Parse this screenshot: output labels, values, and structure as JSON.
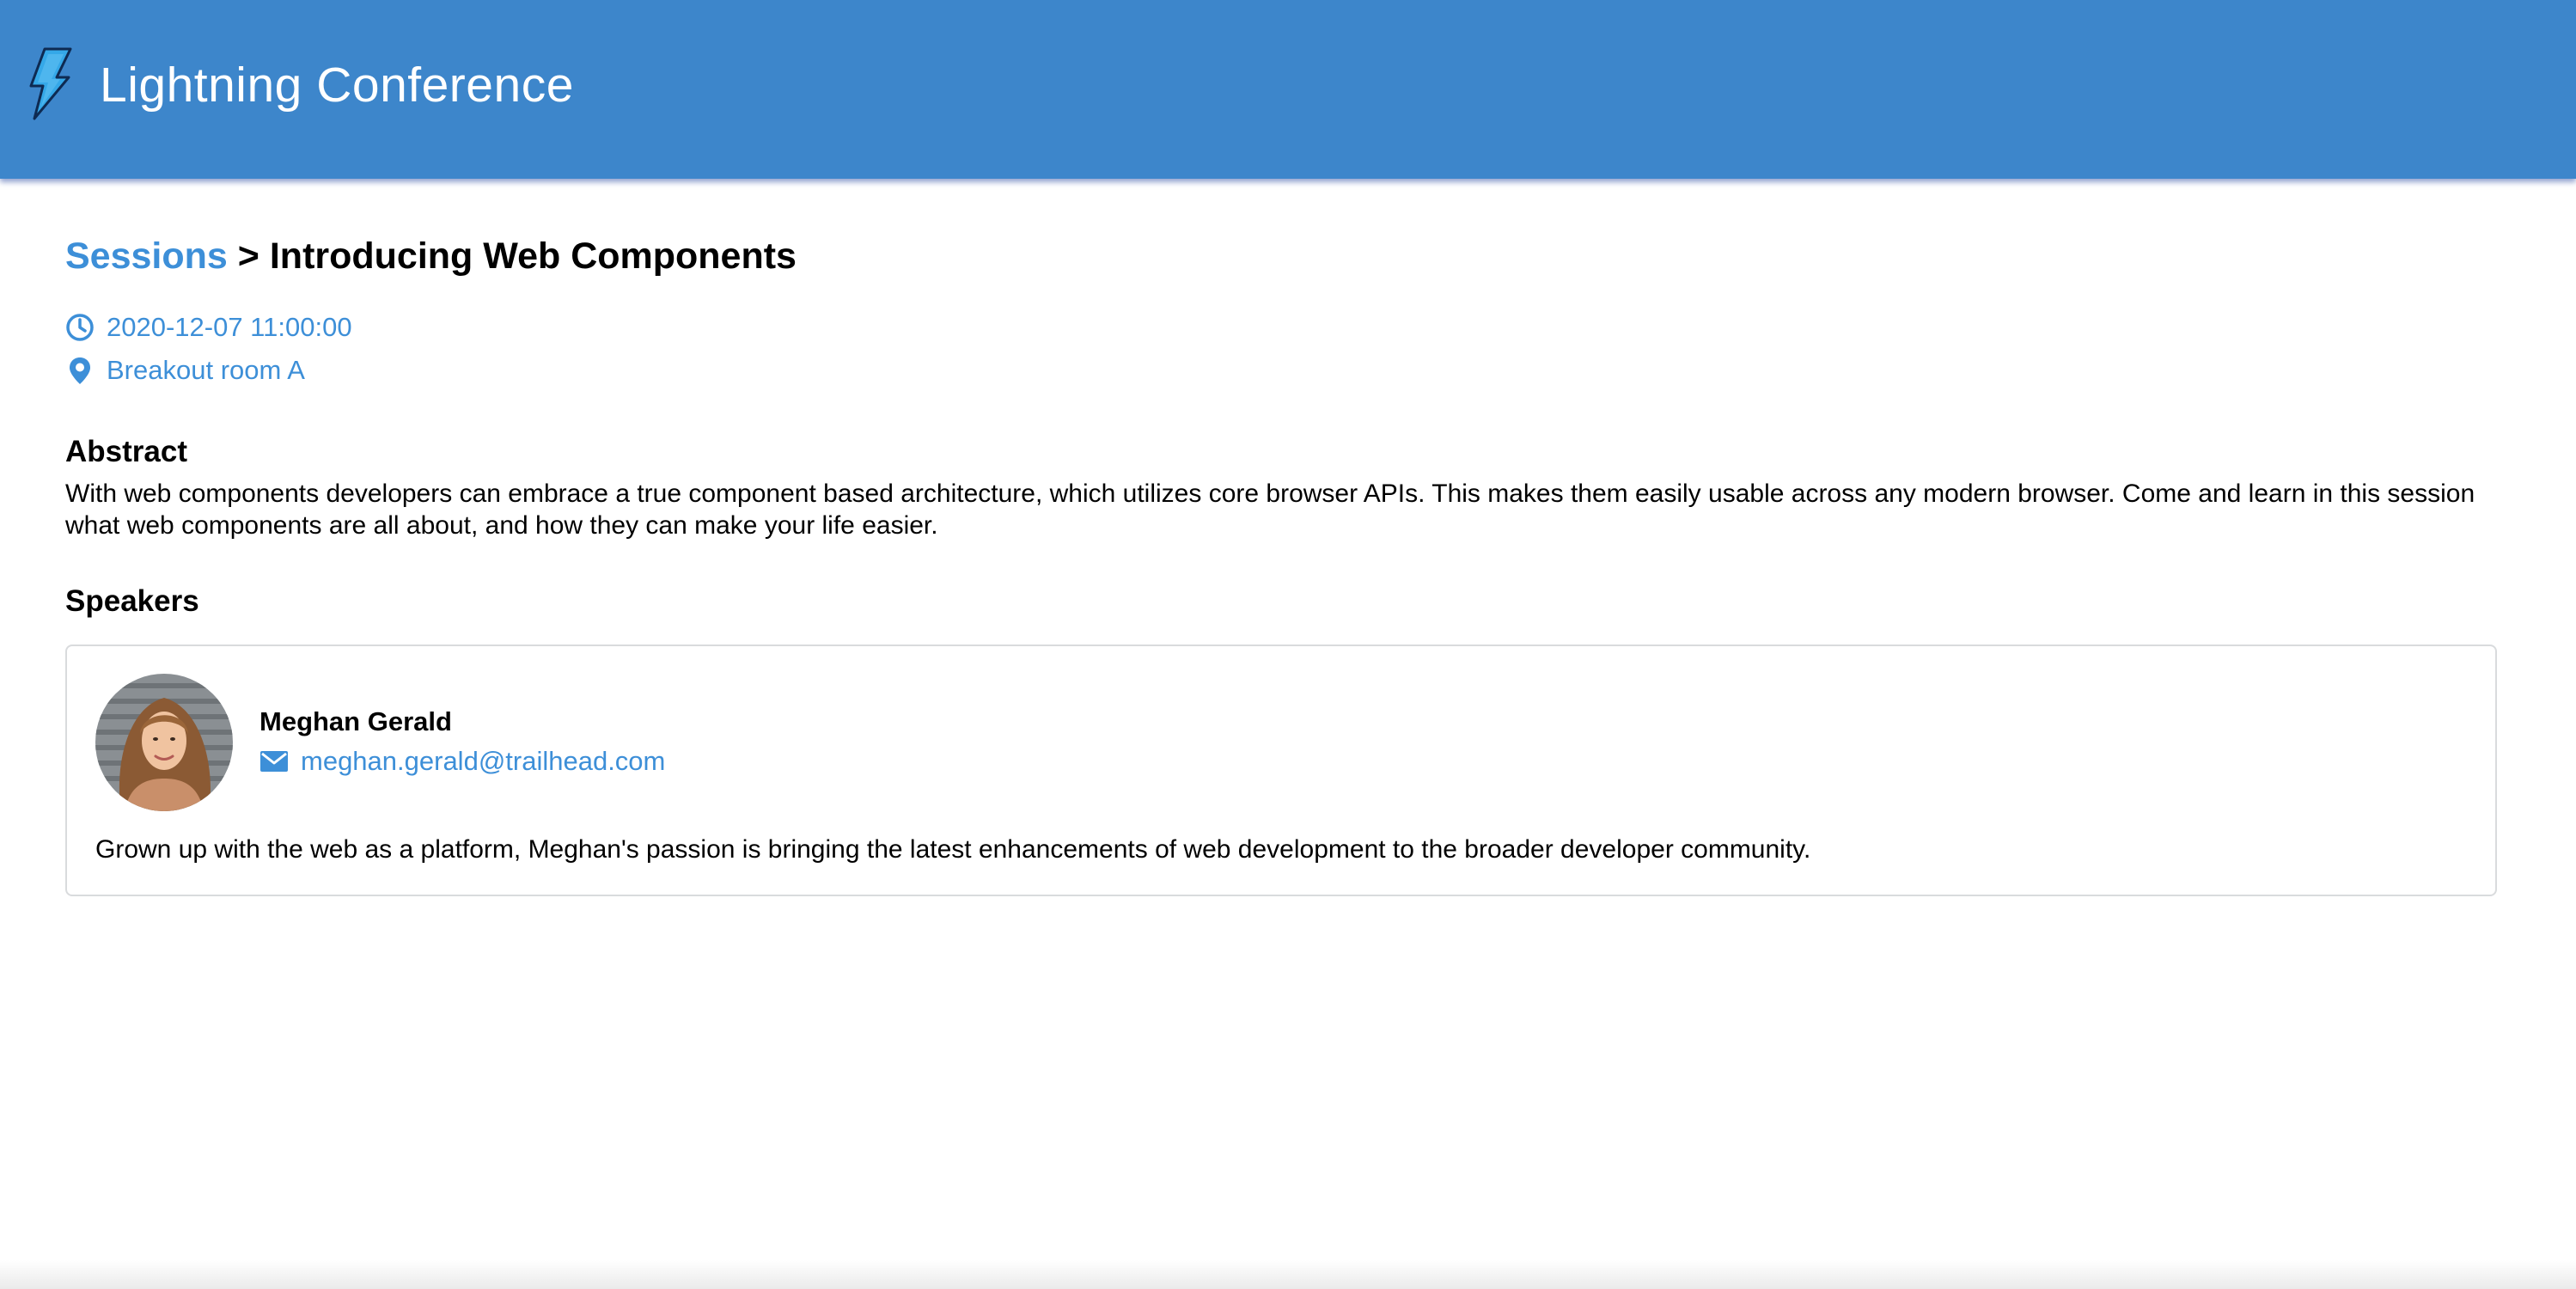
{
  "header": {
    "logo_icon": "lightning-bolt-icon",
    "title": "Lightning Conference"
  },
  "breadcrumb": {
    "parent": "Sessions",
    "separator": ">",
    "current": "Introducing Web Components"
  },
  "session": {
    "datetime": "2020-12-07 11:00:00",
    "datetime_icon": "clock-icon",
    "room": "Breakout room A",
    "room_icon": "location-pin-icon"
  },
  "abstract": {
    "heading": "Abstract",
    "text": "With web components developers can embrace a true component based architecture, which utilizes core browser APIs. This makes them easily usable across any modern browser. Come and learn in this session what web components are all about, and how they can make your life easier."
  },
  "speakers": {
    "heading": "Speakers",
    "items": [
      {
        "name": "Meghan Gerald",
        "email": "meghan.gerald@trailhead.com",
        "email_icon": "envelope-icon",
        "bio": "Grown up with the web as a platform, Meghan's passion is bringing the latest enhancements of web development to the broader developer community."
      }
    ]
  },
  "colors": {
    "header_bg": "#3d86cb",
    "link": "#3d8fd8",
    "text": "#000000",
    "card_border": "#d9dbdd"
  }
}
